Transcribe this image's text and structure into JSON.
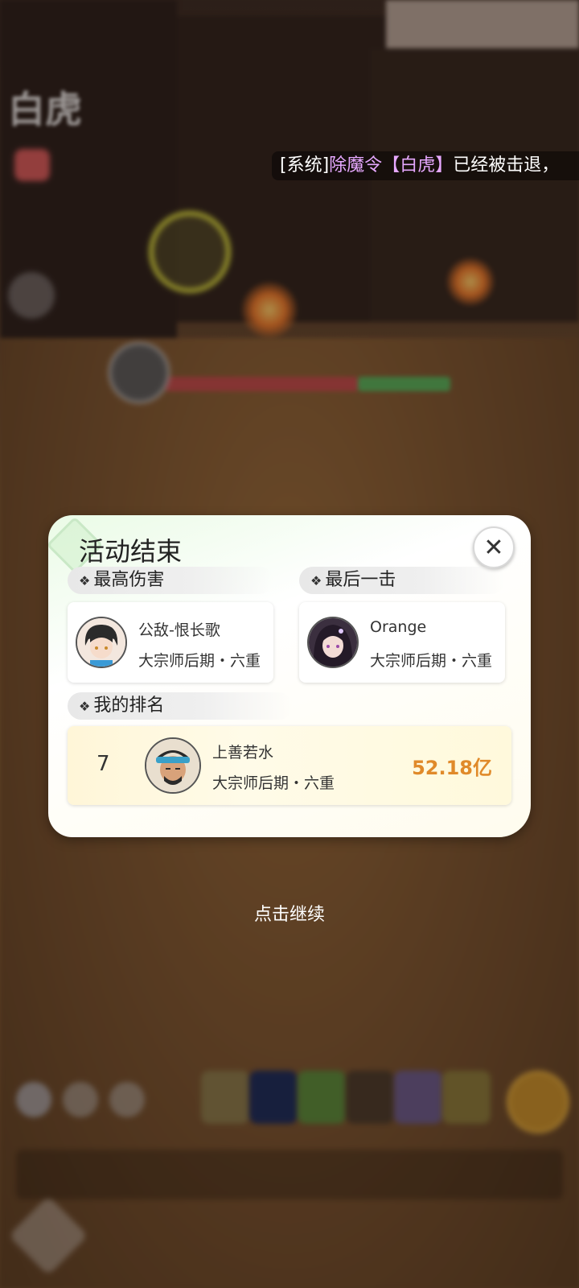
{
  "scene": {
    "boss_name": "白虎"
  },
  "system_message": {
    "prefix": "[系统]",
    "item": "除魔令",
    "bracket_open": "【",
    "boss": "白虎",
    "bracket_close": "】",
    "suffix": "已经被击退，"
  },
  "panel": {
    "title": "活动结束",
    "close_icon": "close-icon",
    "top_damage": {
      "header": "最高伤害",
      "player_name": "公敌-恨长歌",
      "player_rank": "大宗师后期・六重"
    },
    "last_hit": {
      "header": "最后一击",
      "player_name": "Orange",
      "player_rank": "大宗师后期・六重"
    },
    "my_ranking": {
      "header": "我的排名",
      "rank": "7",
      "player_name": "上善若水",
      "player_rank": "大宗师后期・六重",
      "score": "52.18亿"
    }
  },
  "continue_label": "点击继续",
  "colors": {
    "score": "#e08a2a",
    "system_highlight": "#e6a8ff"
  }
}
